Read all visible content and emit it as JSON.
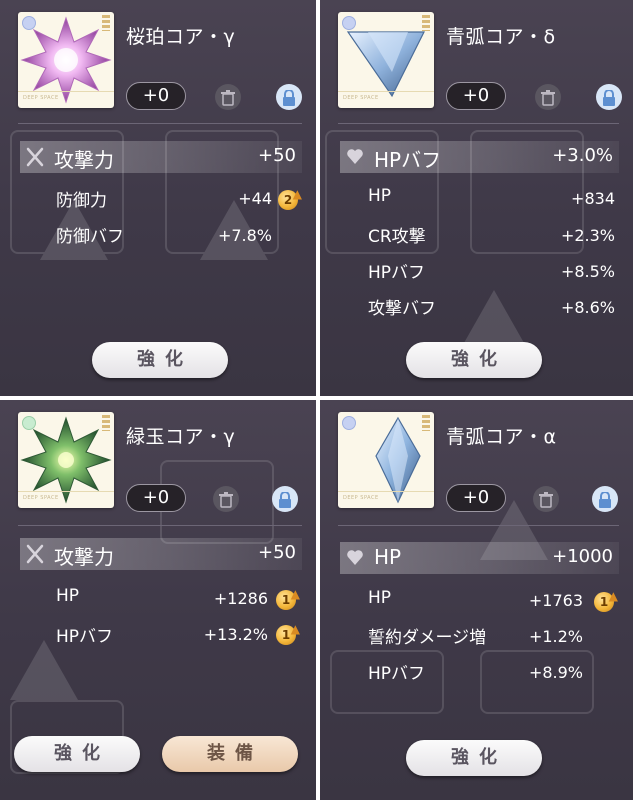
{
  "panels": [
    {
      "title": "桜珀コア・γ",
      "level": "+0",
      "main": {
        "name": "攻撃力",
        "value": "+50",
        "icon": "sword-icon"
      },
      "subs": [
        {
          "name": "防御力",
          "value": "+44",
          "badge": "2"
        },
        {
          "name": "防御バフ",
          "value": "+7.8%"
        }
      ],
      "buttons": [
        "強化"
      ],
      "gem_color": "#d48ad8"
    },
    {
      "title": "青弧コア・δ",
      "level": "+0",
      "main": {
        "name": "HPバフ",
        "value": "+3.0%",
        "icon": "heart-icon"
      },
      "subs": [
        {
          "name": "HP",
          "value": "+834"
        },
        {
          "name": "CR攻撃",
          "value": "+2.3%"
        },
        {
          "name": "HPバフ",
          "value": "+8.5%"
        },
        {
          "name": "攻撃バフ",
          "value": "+8.6%"
        }
      ],
      "buttons": [
        "強化"
      ],
      "gem_color": "#7ea8d8"
    },
    {
      "title": "緑玉コア・γ",
      "level": "+0",
      "main": {
        "name": "攻撃力",
        "value": "+50",
        "icon": "sword-icon"
      },
      "subs": [
        {
          "name": "HP",
          "value": "+1286",
          "badge": "1"
        },
        {
          "name": "HPバフ",
          "value": "+13.2%",
          "badge": "1"
        }
      ],
      "buttons": [
        "強化",
        "装備"
      ],
      "gem_color": "#7fbf6a"
    },
    {
      "title": "青弧コア・α",
      "level": "+0",
      "main": {
        "name": "HP",
        "value": "+1000",
        "icon": "heart-icon"
      },
      "subs": [
        {
          "name": "HP",
          "value": "+1763",
          "badge": "1"
        },
        {
          "name": "誓約ダメージ増",
          "value": "+1.2%"
        },
        {
          "name": "HPバフ",
          "value": "+8.9%"
        }
      ],
      "buttons": [
        "強化"
      ],
      "gem_color": "#8db3de"
    }
  ]
}
